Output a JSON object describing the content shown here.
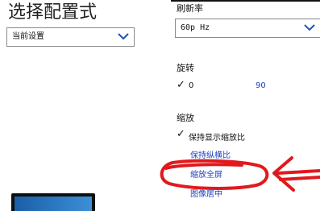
{
  "header": {
    "title": "选择配置式"
  },
  "preset": {
    "selected": "当前设置"
  },
  "refresh_rate": {
    "label": "刷新率",
    "selected": "60p Hz"
  },
  "rotation": {
    "label": "旋转",
    "check": "✓",
    "options": [
      "0",
      "90"
    ]
  },
  "scaling": {
    "label": "缩放",
    "check": "✓",
    "options": [
      "保持显示缩放比",
      "保持纵横比",
      "缩放全屏",
      "图像居中"
    ],
    "selected_index": 0
  },
  "annotation": {
    "color": "#e0191d"
  },
  "colors": {
    "link": "#1f3fbf",
    "monitor_screen": "#2a78c4"
  }
}
